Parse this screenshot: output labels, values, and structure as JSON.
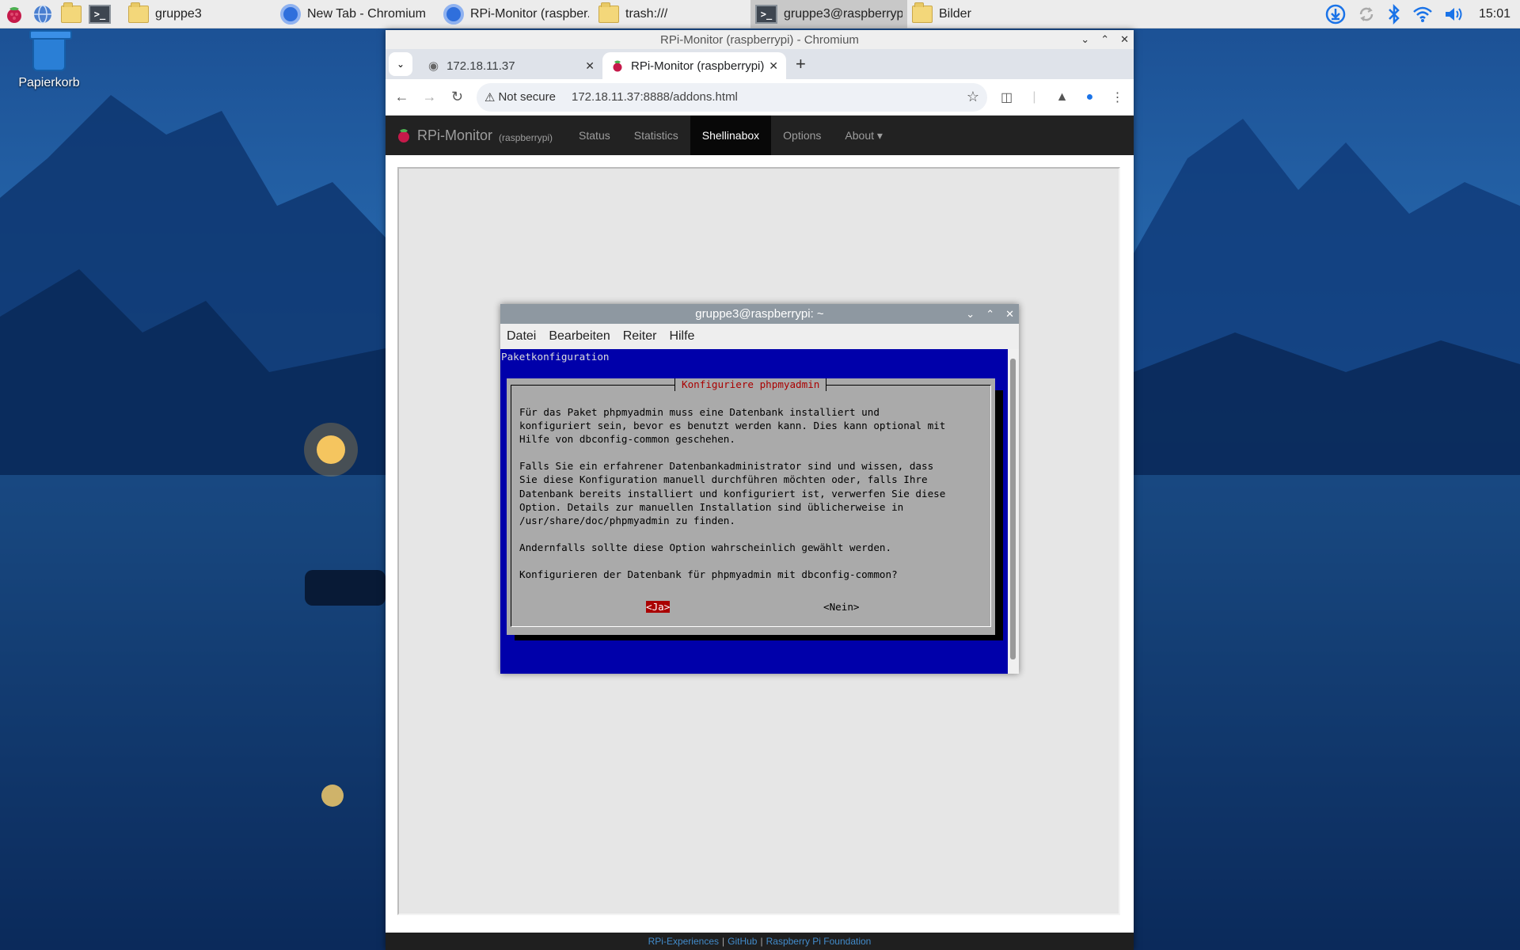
{
  "taskbar": {
    "tasks": [
      {
        "label": "gruppe3",
        "icon": "folder-icon",
        "active": false
      },
      {
        "label": "New Tab - Chromium",
        "icon": "chromium-icon",
        "active": false
      },
      {
        "label": "RPi-Monitor (raspber...",
        "icon": "chromium-icon",
        "active": false
      },
      {
        "label": "trash:///",
        "icon": "folder-icon",
        "active": false
      },
      {
        "label": "gruppe3@raspberryp...",
        "icon": "terminal-icon",
        "active": true
      },
      {
        "label": "Bilder",
        "icon": "folder-icon",
        "active": false
      }
    ],
    "clock": "15:01"
  },
  "desktop": {
    "trash_label": "Papierkorb"
  },
  "chromium": {
    "window_title": "RPi-Monitor (raspberrypi) - Chromium",
    "tabs": [
      {
        "title": "172.18.11.37",
        "active": false
      },
      {
        "title": "RPi-Monitor (raspberrypi)",
        "active": true
      }
    ],
    "security_label": "Not secure",
    "url": "172.18.11.37:8888/addons.html"
  },
  "page": {
    "brand": "RPi-Monitor",
    "brand_host": "(raspberrypi)",
    "nav": [
      {
        "label": "Status",
        "active": false
      },
      {
        "label": "Statistics",
        "active": false
      },
      {
        "label": "Shellinabox",
        "active": true
      },
      {
        "label": "Options",
        "active": false
      },
      {
        "label": "About ▾",
        "active": false
      }
    ],
    "footer": {
      "link1": "RPi-Experiences",
      "link2": "GitHub",
      "link3": "Raspberry Pi Foundation",
      "separator": "|"
    }
  },
  "terminal": {
    "title": "gruppe3@raspberrypi: ~",
    "menu": [
      "Datei",
      "Bearbeiten",
      "Reiter",
      "Hilfe"
    ],
    "header": "Paketkonfiguration",
    "dialog_title": "Konfiguriere phpmyadmin",
    "dialog_text": "Für das Paket phpmyadmin muss eine Datenbank installiert und\nkonfiguriert sein, bevor es benutzt werden kann. Dies kann optional mit\nHilfe von dbconfig-common geschehen.\n\nFalls Sie ein erfahrener Datenbankadministrator sind und wissen, dass\nSie diese Konfiguration manuell durchführen möchten oder, falls Ihre\nDatenbank bereits installiert und konfiguriert ist, verwerfen Sie diese\nOption. Details zur manuellen Installation sind üblicherweise in\n/usr/share/doc/phpmyadmin zu finden.\n\nAndernfalls sollte diese Option wahrscheinlich gewählt werden.\n\nKonfigurieren der Datenbank für phpmyadmin mit dbconfig-common?",
    "btn_yes": "<Ja>",
    "btn_no": "<Nein>"
  }
}
